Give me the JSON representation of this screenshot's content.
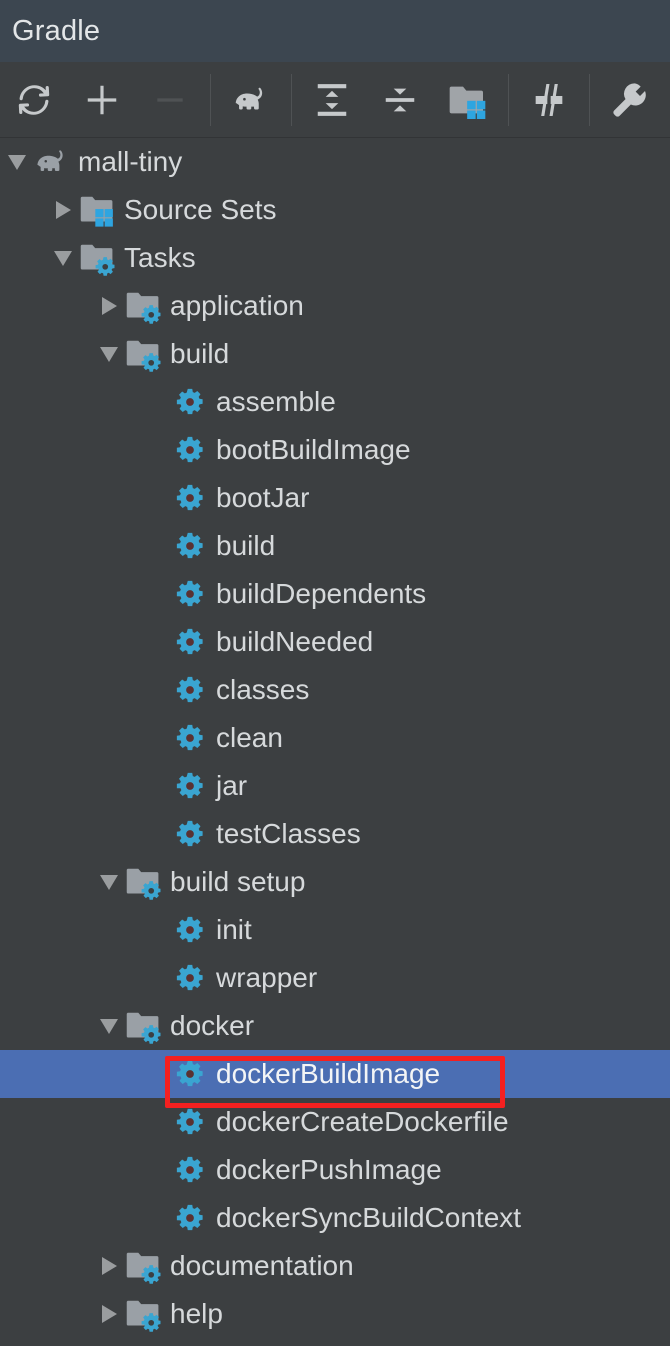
{
  "window": {
    "title": "Gradle",
    "header_bg": "#3c4650",
    "panel_bg": "#3c3f41"
  },
  "toolbar": {
    "buttons": [
      {
        "name": "reload-all-gradle-projects",
        "icon": "refresh-icon",
        "enabled": true
      },
      {
        "name": "link-gradle-project",
        "icon": "plus-icon",
        "enabled": true
      },
      {
        "name": "detach-external-project",
        "icon": "minus-icon",
        "enabled": false
      },
      {
        "name": "execute-gradle-task",
        "icon": "elephant-icon",
        "enabled": true
      },
      {
        "name": "expand-all",
        "icon": "expand-all-icon",
        "enabled": true
      },
      {
        "name": "collapse-all",
        "icon": "collapse-all-icon",
        "enabled": true
      },
      {
        "name": "show-source-sets",
        "icon": "folder-grid-icon",
        "enabled": true
      },
      {
        "name": "toggle-offline-mode",
        "icon": "offline-mode-icon",
        "enabled": true
      },
      {
        "name": "gradle-settings",
        "icon": "wrench-icon",
        "enabled": true
      }
    ]
  },
  "tree": {
    "selection_color": "#4b6eb3",
    "gear_color": "#3aa5d1",
    "folder_color": "#9aa0a6",
    "annotation": {
      "color": "#f42020",
      "target": "dockerBuildImage"
    },
    "nodes": [
      {
        "label": "mall-tiny",
        "depth": 0,
        "icon": "elephant-icon",
        "state": "expanded",
        "selected": false
      },
      {
        "label": "Source Sets",
        "depth": 1,
        "icon": "folder-grid-icon",
        "state": "collapsed",
        "selected": false
      },
      {
        "label": "Tasks",
        "depth": 1,
        "icon": "folder-gear-icon",
        "state": "expanded",
        "selected": false
      },
      {
        "label": "application",
        "depth": 2,
        "icon": "folder-gear-icon",
        "state": "collapsed",
        "selected": false
      },
      {
        "label": "build",
        "depth": 2,
        "icon": "folder-gear-icon",
        "state": "expanded",
        "selected": false
      },
      {
        "label": "assemble",
        "depth": 3,
        "icon": "gear-icon",
        "state": "leaf",
        "selected": false
      },
      {
        "label": "bootBuildImage",
        "depth": 3,
        "icon": "gear-icon",
        "state": "leaf",
        "selected": false
      },
      {
        "label": "bootJar",
        "depth": 3,
        "icon": "gear-icon",
        "state": "leaf",
        "selected": false
      },
      {
        "label": "build",
        "depth": 3,
        "icon": "gear-icon",
        "state": "leaf",
        "selected": false
      },
      {
        "label": "buildDependents",
        "depth": 3,
        "icon": "gear-icon",
        "state": "leaf",
        "selected": false
      },
      {
        "label": "buildNeeded",
        "depth": 3,
        "icon": "gear-icon",
        "state": "leaf",
        "selected": false
      },
      {
        "label": "classes",
        "depth": 3,
        "icon": "gear-icon",
        "state": "leaf",
        "selected": false
      },
      {
        "label": "clean",
        "depth": 3,
        "icon": "gear-icon",
        "state": "leaf",
        "selected": false
      },
      {
        "label": "jar",
        "depth": 3,
        "icon": "gear-icon",
        "state": "leaf",
        "selected": false
      },
      {
        "label": "testClasses",
        "depth": 3,
        "icon": "gear-icon",
        "state": "leaf",
        "selected": false
      },
      {
        "label": "build setup",
        "depth": 2,
        "icon": "folder-gear-icon",
        "state": "expanded",
        "selected": false
      },
      {
        "label": "init",
        "depth": 3,
        "icon": "gear-icon",
        "state": "leaf",
        "selected": false
      },
      {
        "label": "wrapper",
        "depth": 3,
        "icon": "gear-icon",
        "state": "leaf",
        "selected": false
      },
      {
        "label": "docker",
        "depth": 2,
        "icon": "folder-gear-icon",
        "state": "expanded",
        "selected": false
      },
      {
        "label": "dockerBuildImage",
        "depth": 3,
        "icon": "gear-icon",
        "state": "leaf",
        "selected": true
      },
      {
        "label": "dockerCreateDockerfile",
        "depth": 3,
        "icon": "gear-icon",
        "state": "leaf",
        "selected": false
      },
      {
        "label": "dockerPushImage",
        "depth": 3,
        "icon": "gear-icon",
        "state": "leaf",
        "selected": false
      },
      {
        "label": "dockerSyncBuildContext",
        "depth": 3,
        "icon": "gear-icon",
        "state": "leaf",
        "selected": false
      },
      {
        "label": "documentation",
        "depth": 2,
        "icon": "folder-gear-icon",
        "state": "collapsed",
        "selected": false
      },
      {
        "label": "help",
        "depth": 2,
        "icon": "folder-gear-icon",
        "state": "collapsed",
        "selected": false
      }
    ]
  }
}
